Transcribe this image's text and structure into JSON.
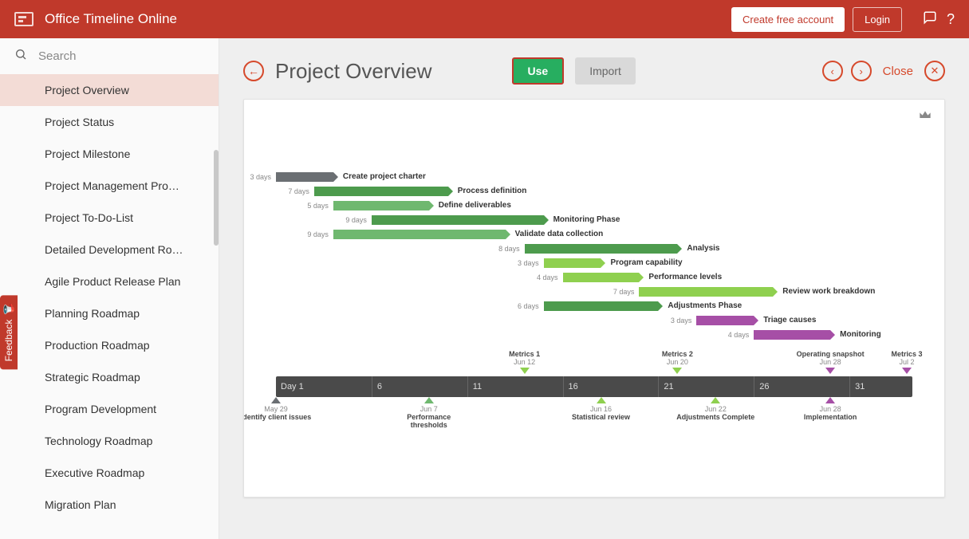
{
  "header": {
    "app_title": "Office Timeline Online",
    "create_account": "Create free account",
    "login": "Login"
  },
  "search": {
    "placeholder": "Search"
  },
  "sidebar_items": [
    "Project Overview",
    "Project Status",
    "Project Milestone",
    "Project Management Pro…",
    "Project To-Do-List",
    "Detailed Development Ro…",
    "Agile Product Release Plan",
    "Planning Roadmap",
    "Production Roadmap",
    "Strategic Roadmap",
    "Program Development",
    "Technology Roadmap",
    "Executive Roadmap",
    "Migration Plan"
  ],
  "active_sidebar_index": 0,
  "page": {
    "title": "Project Overview",
    "use": "Use",
    "import": "Import",
    "close": "Close"
  },
  "feedback": "Feedback",
  "colors": {
    "gray": "#6b6f73",
    "green_dark": "#4d9b4d",
    "green_mid": "#6fb86f",
    "green_light": "#8fd04f",
    "purple": "#a64fa6"
  },
  "chart_data": {
    "type": "gantt",
    "x_unit": "days",
    "x_range": [
      1,
      35
    ],
    "timescale_ticks": [
      {
        "pos": 1,
        "label": "Day 1"
      },
      {
        "pos": 6,
        "label": "6"
      },
      {
        "pos": 11,
        "label": "11"
      },
      {
        "pos": 16,
        "label": "16"
      },
      {
        "pos": 21,
        "label": "21"
      },
      {
        "pos": 26,
        "label": "26"
      },
      {
        "pos": 31,
        "label": "31"
      }
    ],
    "tasks": [
      {
        "row": 0,
        "start": 1,
        "dur": 3,
        "label": "Create project charter",
        "color": "gray"
      },
      {
        "row": 1,
        "start": 3,
        "dur": 7,
        "label": "Process definition",
        "color": "green_dark"
      },
      {
        "row": 2,
        "start": 4,
        "dur": 5,
        "label": "Define deliverables",
        "color": "green_mid"
      },
      {
        "row": 3,
        "start": 6,
        "dur": 9,
        "label": "Monitoring Phase",
        "color": "green_dark"
      },
      {
        "row": 4,
        "start": 4,
        "dur": 9,
        "label": "Validate data collection",
        "color": "green_mid"
      },
      {
        "row": 5,
        "start": 14,
        "dur": 8,
        "label": "Analysis",
        "color": "green_dark"
      },
      {
        "row": 6,
        "start": 15,
        "dur": 3,
        "label": "Program capability",
        "color": "green_light"
      },
      {
        "row": 7,
        "start": 16,
        "dur": 4,
        "label": "Performance levels",
        "color": "green_light"
      },
      {
        "row": 8,
        "start": 20,
        "dur": 7,
        "label": "Review work breakdown",
        "color": "green_light"
      },
      {
        "row": 9,
        "start": 15,
        "dur": 6,
        "label": "Adjustments Phase",
        "color": "green_dark"
      },
      {
        "row": 10,
        "start": 23,
        "dur": 3,
        "label": "Triage causes",
        "color": "purple"
      },
      {
        "row": 11,
        "start": 26,
        "dur": 4,
        "label": "Monitoring",
        "color": "purple"
      }
    ],
    "markers_above": [
      {
        "pos": 14,
        "title": "Metrics 1",
        "date": "Jun 12",
        "color": "green_light"
      },
      {
        "pos": 22,
        "title": "Metrics 2",
        "date": "Jun 20",
        "color": "green_light"
      },
      {
        "pos": 30,
        "title": "Operating snapshot",
        "date": "Jun 28",
        "color": "purple"
      },
      {
        "pos": 34,
        "title": "Metrics 3",
        "date": "Jul 2",
        "color": "purple"
      }
    ],
    "markers_below": [
      {
        "pos": 1,
        "title": "Identify client issues",
        "date": "May 29",
        "color": "gray"
      },
      {
        "pos": 9,
        "title": "Performance thresholds",
        "date": "Jun 7",
        "color": "green_mid"
      },
      {
        "pos": 18,
        "title": "Statistical review",
        "date": "Jun 16",
        "color": "green_light"
      },
      {
        "pos": 24,
        "title": "Adjustments Complete",
        "date": "Jun 22",
        "color": "green_light"
      },
      {
        "pos": 30,
        "title": "Implementation",
        "date": "Jun 28",
        "color": "purple"
      }
    ]
  }
}
